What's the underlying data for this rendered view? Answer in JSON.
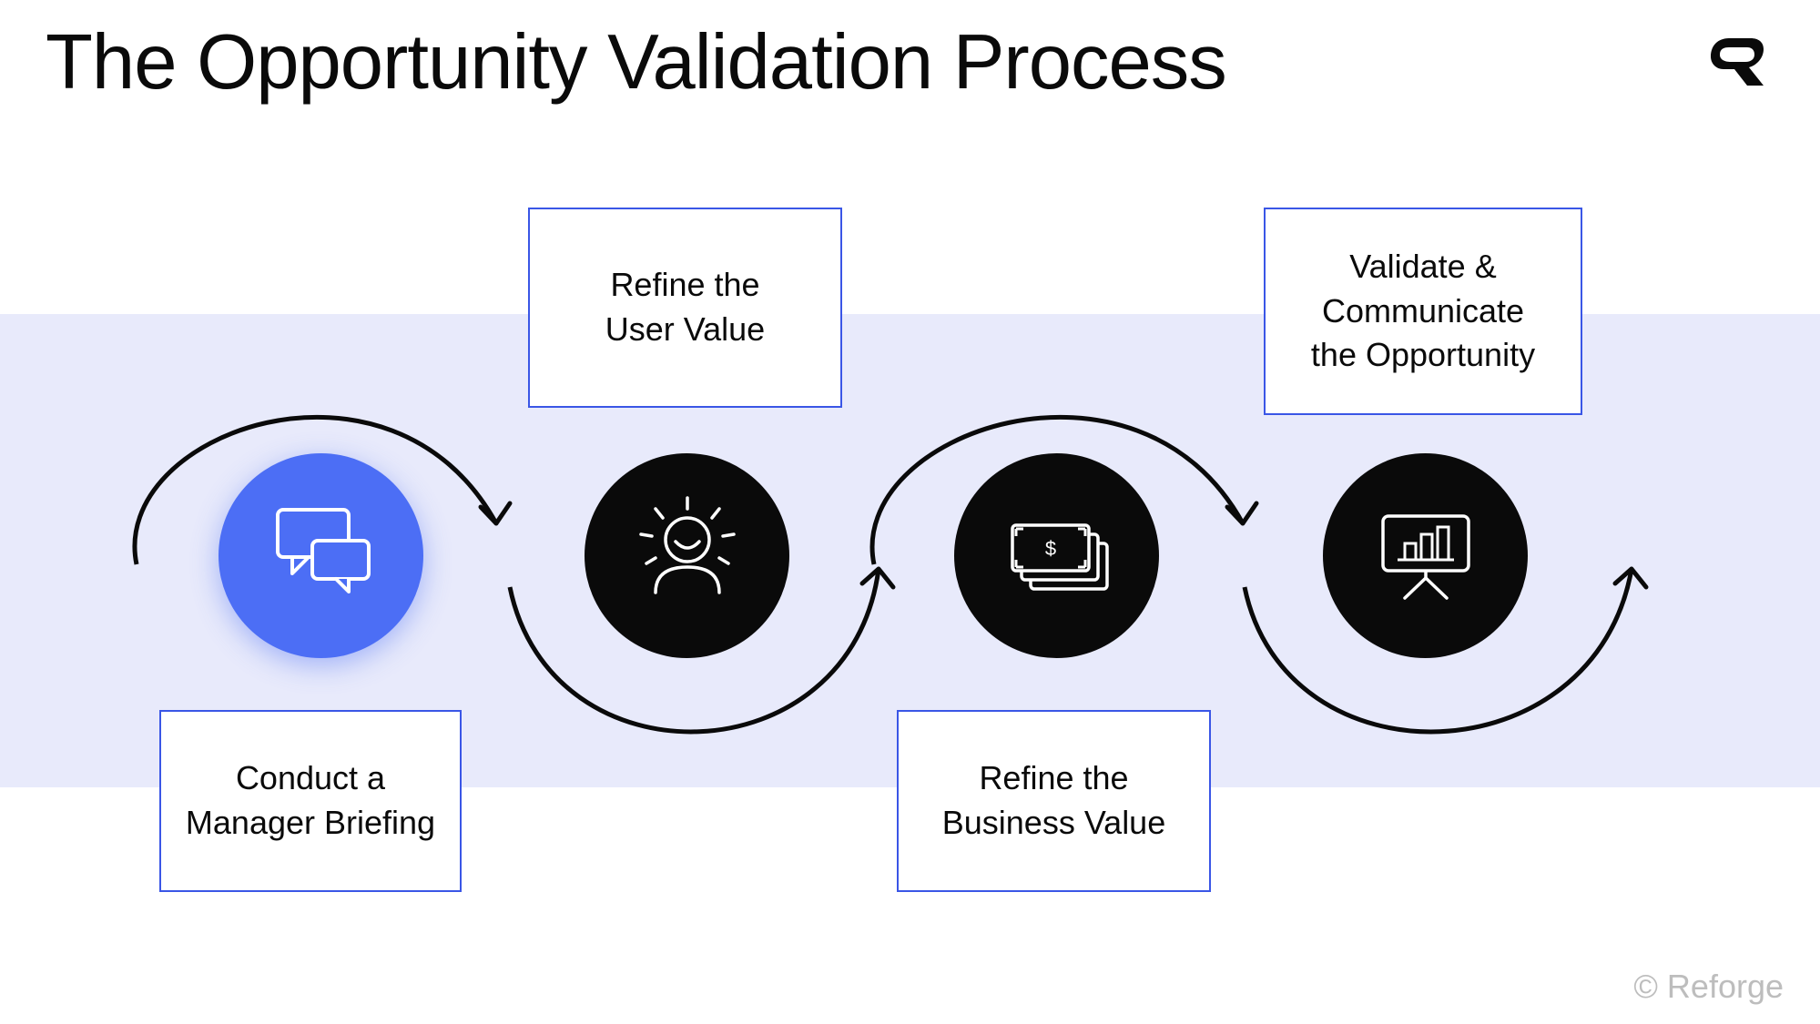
{
  "title": "The Opportunity Validation Process",
  "steps": [
    {
      "label": "Conduct a\nManager Briefing",
      "icon": "chat-bubbles-icon",
      "circle_color": "blue"
    },
    {
      "label": "Refine the\nUser Value",
      "icon": "happy-user-icon",
      "circle_color": "black"
    },
    {
      "label": "Refine the\nBusiness Value",
      "icon": "money-stack-icon",
      "circle_color": "black"
    },
    {
      "label": "Validate &\nCommunicate\nthe Opportunity",
      "icon": "presentation-chart-icon",
      "circle_color": "black"
    }
  ],
  "colors": {
    "accent_blue": "#4c6ef5",
    "box_border": "#3a56e6",
    "band_bg": "#e8eafb",
    "icon_black": "#0a0a0a",
    "footer_grey": "#bdbdbd"
  },
  "footer": "© Reforge"
}
